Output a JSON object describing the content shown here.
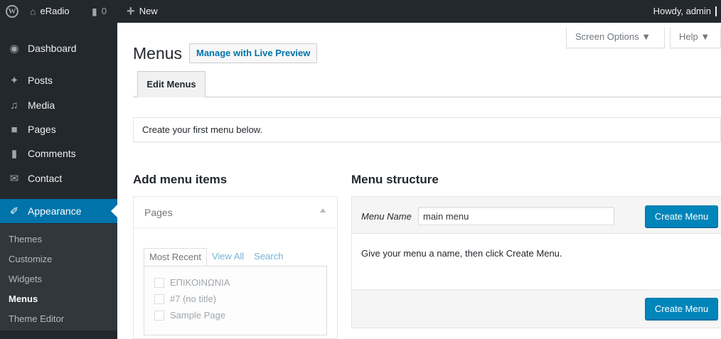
{
  "adminbar": {
    "site_name": "eRadio",
    "comments_count": "0",
    "new_label": "New",
    "howdy": "Howdy, admin"
  },
  "sidebar": {
    "items": [
      {
        "label": "Dashboard",
        "icon": "dashboard-icon"
      },
      {
        "label": "Posts",
        "icon": "pin-icon"
      },
      {
        "label": "Media",
        "icon": "media-icon"
      },
      {
        "label": "Pages",
        "icon": "pages-icon"
      },
      {
        "label": "Comments",
        "icon": "comment-icon"
      },
      {
        "label": "Contact",
        "icon": "mail-icon"
      },
      {
        "label": "Appearance",
        "icon": "brush-icon"
      }
    ],
    "submenu": [
      "Themes",
      "Customize",
      "Widgets",
      "Menus",
      "Theme Editor"
    ],
    "current_submenu": "Menus",
    "accent_color": "#0073aa"
  },
  "header": {
    "title": "Menus",
    "live_preview_label": "Manage with Live Preview",
    "screen_options": "Screen Options ▼",
    "help": "Help ▼"
  },
  "tabs": {
    "edit_menus": "Edit Menus"
  },
  "notice": "Create your first menu below.",
  "add_items": {
    "heading": "Add menu items",
    "pages_title": "Pages",
    "tabs": [
      "Most Recent",
      "View All",
      "Search"
    ],
    "pages": [
      "ΕΠΙΚΟΙΝΩΝΙΑ",
      "#7 (no title)",
      "Sample Page"
    ]
  },
  "structure": {
    "heading": "Menu structure",
    "menu_name_label": "Menu Name",
    "menu_name_value": "main menu",
    "create_label": "Create Menu",
    "instructions": "Give your menu a name, then click Create Menu.",
    "button_color": "#0085ba"
  }
}
